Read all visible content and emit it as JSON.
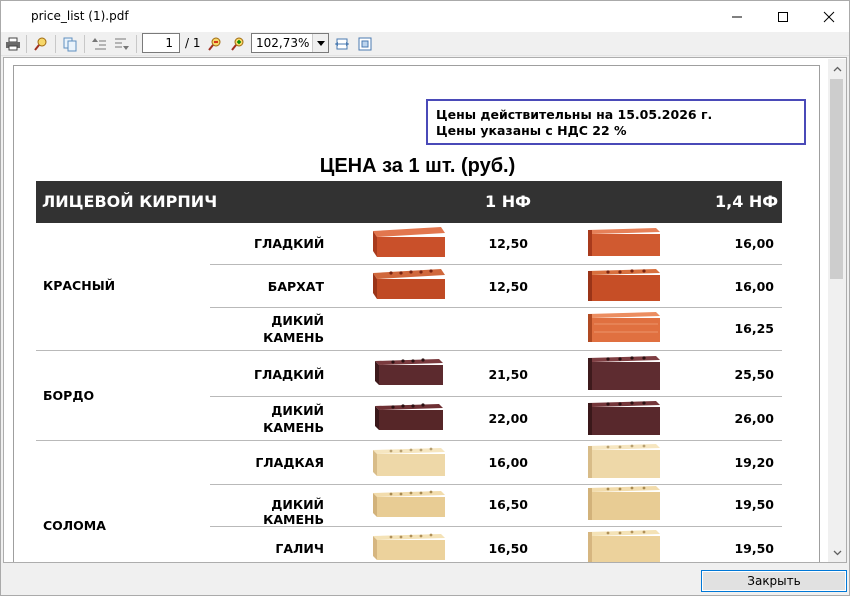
{
  "window": {
    "title": "price_list (1).pdf"
  },
  "toolbar": {
    "page_current": "1",
    "page_total": "/ 1",
    "zoom": "102,73%"
  },
  "document": {
    "notice_line1": "Цены действительны на 15.05.2026 г.",
    "notice_line2": "Цены указаны с НДС 22 %",
    "title": "ЦЕНА за 1 шт. (руб.)",
    "header": {
      "category": "ЛИЦЕВОЙ КИРПИЧ",
      "col1": "1 НФ",
      "col2": "1,4 НФ"
    },
    "groups": [
      {
        "name": "КРАСНЫЙ",
        "rows": [
          {
            "type": "ГЛАДКИЙ",
            "p1": "12,50",
            "p2": "16,00"
          },
          {
            "type": "БАРХАТ",
            "p1": "12,50",
            "p2": "16,00"
          },
          {
            "type_line1": "ДИКИЙ",
            "type_line2": "КАМЕНЬ",
            "p1": "",
            "p2": "16,25"
          }
        ]
      },
      {
        "name": "БОРДО",
        "rows": [
          {
            "type": "ГЛАДКИЙ",
            "p1": "21,50",
            "p2": "25,50"
          },
          {
            "type_line1": "ДИКИЙ",
            "type_line2": "КАМЕНЬ",
            "p1": "22,00",
            "p2": "26,00"
          }
        ]
      },
      {
        "name": "СОЛОМА",
        "rows": [
          {
            "type": "ГЛАДКАЯ",
            "p1": "16,00",
            "p2": "19,20"
          },
          {
            "type": "ДИКИЙ КАМЕНЬ",
            "p1": "16,50",
            "p2": "19,50"
          },
          {
            "type": "ГАЛИЧ",
            "p1": "16,50",
            "p2": "19,50"
          }
        ]
      }
    ]
  },
  "footer": {
    "close_label": "Закрыть"
  },
  "colors": {
    "header_bg": "#323232",
    "notice_border": "#4a4ab8",
    "brick_red": "#c9502a",
    "brick_bordo": "#5c2a2e",
    "brick_straw": "#eed8a8"
  }
}
